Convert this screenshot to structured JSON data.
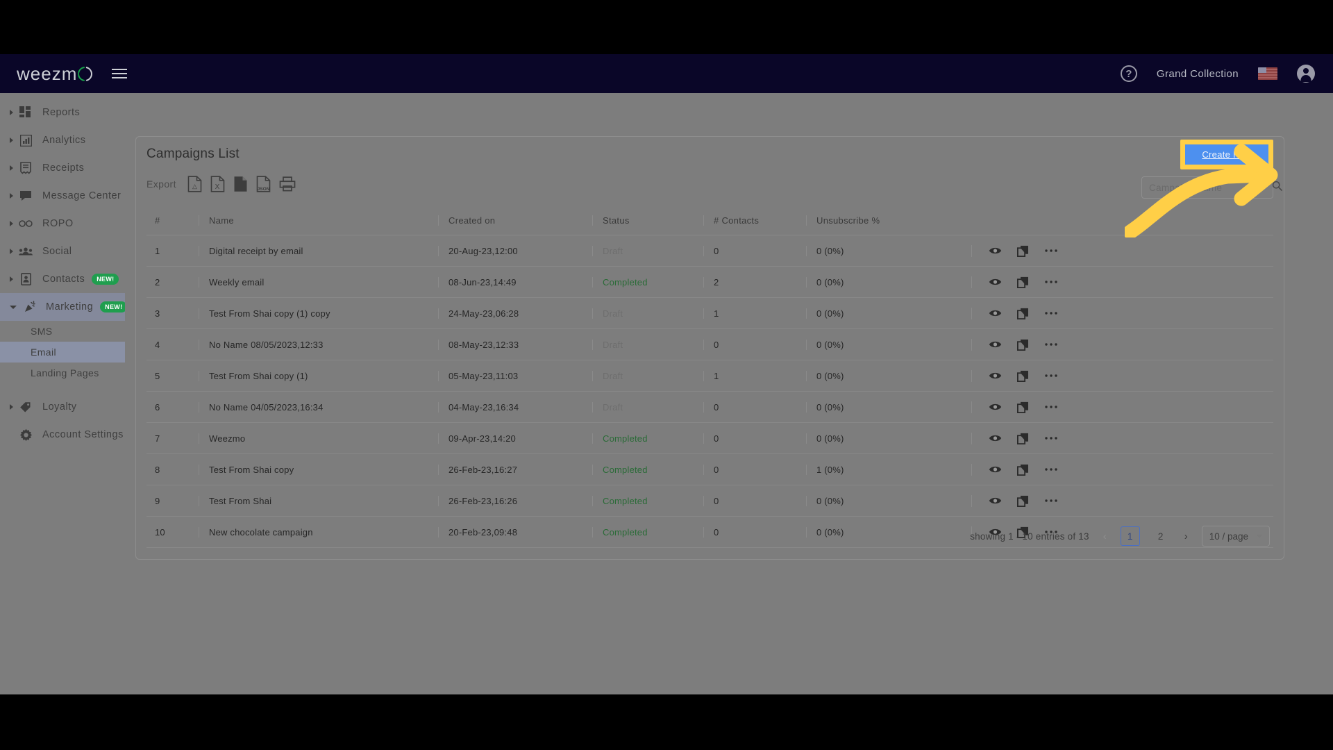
{
  "topbar": {
    "logo_text": "weezm",
    "logo_icon": "weezmo-logo-circle",
    "menu_icon": "hamburger-menu-icon",
    "help_icon": "?",
    "account_name": "Grand Collection",
    "flag_icon": "us-flag-icon",
    "avatar_icon": "account-avatar-icon"
  },
  "sidebar": {
    "items": [
      {
        "label": "Reports",
        "icon": "reports-grid-icon",
        "expandable": true,
        "badge": null
      },
      {
        "label": "Analytics",
        "icon": "analytics-chart-icon",
        "expandable": true,
        "badge": null
      },
      {
        "label": "Receipts",
        "icon": "receipt-icon",
        "expandable": true,
        "badge": null
      },
      {
        "label": "Message Center",
        "icon": "chat-bubble-icon",
        "expandable": true,
        "badge": null
      },
      {
        "label": "ROPO",
        "icon": "infinity-icon",
        "expandable": true,
        "badge": null
      },
      {
        "label": "Social",
        "icon": "people-group-icon",
        "expandable": true,
        "badge": null
      },
      {
        "label": "Contacts",
        "icon": "contact-card-icon",
        "expandable": true,
        "badge": "NEW!"
      },
      {
        "label": "Marketing",
        "icon": "megaphone-icon",
        "expandable": true,
        "badge": "NEW!"
      }
    ],
    "marketing_children": [
      {
        "label": "SMS",
        "selected": false
      },
      {
        "label": "Email",
        "selected": true
      },
      {
        "label": "Landing Pages",
        "selected": false
      }
    ],
    "bottom_items": [
      {
        "label": "Loyalty",
        "icon": "tag-icon",
        "expandable": true
      },
      {
        "label": "Account Settings",
        "icon": "gear-icon",
        "expandable": false
      }
    ]
  },
  "card": {
    "title": "Campaigns List",
    "export_label": "Export",
    "export_icons": [
      {
        "name": "export-pdf-icon",
        "label": "PDF"
      },
      {
        "name": "export-excel-icon",
        "label": "X"
      },
      {
        "name": "export-csv-icon",
        "label": ""
      },
      {
        "name": "export-json-icon",
        "label": "JSON"
      },
      {
        "name": "print-icon",
        "label": ""
      }
    ],
    "create_new_label": "Create New",
    "search_placeholder": "Campaign Name",
    "search_value": "",
    "search_icon": "search-magnifier-icon"
  },
  "table": {
    "columns": [
      "#",
      "Name",
      "Created on",
      "Status",
      "# Contacts",
      "Unsubscribe %"
    ],
    "row_action_icons": [
      "eye-preview-icon",
      "duplicate-copy-icon",
      "more-options-icon"
    ],
    "rows": [
      {
        "num": "1",
        "name": "Digital receipt by email",
        "created_on": "20-Aug-23,12:00",
        "status": "Draft",
        "contacts": "0",
        "unsubscribe": "0 (0%)"
      },
      {
        "num": "2",
        "name": "Weekly email",
        "created_on": "08-Jun-23,14:49",
        "status": "Completed",
        "contacts": "2",
        "unsubscribe": "0 (0%)"
      },
      {
        "num": "3",
        "name": "Test From Shai copy (1) copy",
        "created_on": "24-May-23,06:28",
        "status": "Draft",
        "contacts": "1",
        "unsubscribe": "0 (0%)"
      },
      {
        "num": "4",
        "name": "No Name 08/05/2023,12:33",
        "created_on": "08-May-23,12:33",
        "status": "Draft",
        "contacts": "0",
        "unsubscribe": "0 (0%)"
      },
      {
        "num": "5",
        "name": "Test From Shai copy (1)",
        "created_on": "05-May-23,11:03",
        "status": "Draft",
        "contacts": "1",
        "unsubscribe": "0 (0%)"
      },
      {
        "num": "6",
        "name": "No Name 04/05/2023,16:34",
        "created_on": "04-May-23,16:34",
        "status": "Draft",
        "contacts": "0",
        "unsubscribe": "0 (0%)"
      },
      {
        "num": "7",
        "name": "Weezmo",
        "created_on": "09-Apr-23,14:20",
        "status": "Completed",
        "contacts": "0",
        "unsubscribe": "0 (0%)"
      },
      {
        "num": "8",
        "name": "Test From Shai copy",
        "created_on": "26-Feb-23,16:27",
        "status": "Completed",
        "contacts": "0",
        "unsubscribe": "1 (0%)"
      },
      {
        "num": "9",
        "name": "Test From Shai",
        "created_on": "26-Feb-23,16:26",
        "status": "Completed",
        "contacts": "0",
        "unsubscribe": "0 (0%)"
      },
      {
        "num": "10",
        "name": "New chocolate campaign",
        "created_on": "20-Feb-23,09:48",
        "status": "Completed",
        "contacts": "0",
        "unsubscribe": "0 (0%)"
      }
    ]
  },
  "pagination": {
    "showing_text": "showing 1 - 10 entries of 13",
    "prev_label": "‹",
    "next_label": "›",
    "pages": [
      "1",
      "2"
    ],
    "active_page": "1",
    "page_size_label": "10 / page"
  },
  "annotation": {
    "arrow_color": "#ffcf47",
    "highlight_color": "#ffcf47"
  },
  "colors": {
    "topbar_bg": "#0a0628",
    "accent_green": "#17a64a",
    "badge_green": "#1f9e4e",
    "button_blue": "#4d90ef",
    "status_completed": "#2a6b37",
    "status_draft": "#6e6e6e"
  }
}
